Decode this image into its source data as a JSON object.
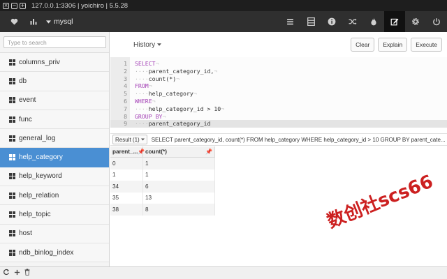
{
  "window": {
    "title": "127.0.0.1:3306 | yoichiro | 5.5.28",
    "controls": [
      "×",
      "−",
      "+"
    ]
  },
  "toolbar": {
    "database": "mysql",
    "left_icons": [
      "heart-icon",
      "bar-chart-icon"
    ],
    "right_icons": [
      "database-list-icon",
      "table-icon",
      "info-icon",
      "shuffle-icon",
      "fire-icon",
      "edit-icon",
      "gear-icon",
      "power-icon"
    ],
    "active_icon": "edit-icon"
  },
  "sidebar": {
    "search_placeholder": "Type to search",
    "selected": "help_category",
    "tables": [
      "columns_priv",
      "db",
      "event",
      "func",
      "general_log",
      "help_category",
      "help_keyword",
      "help_relation",
      "help_topic",
      "host",
      "ndb_binlog_index"
    ]
  },
  "query": {
    "history_label": "History",
    "buttons": {
      "clear": "Clear",
      "explain": "Explain",
      "execute": "Execute"
    },
    "line_numbers": [
      "1",
      "2",
      "3",
      "4",
      "5",
      "6",
      "7",
      "8",
      "9"
    ],
    "lines": [
      {
        "kw": "SELECT",
        "text": ""
      },
      {
        "kw": "",
        "text": "parent_category_id,"
      },
      {
        "kw": "",
        "text": "count(*)"
      },
      {
        "kw": "FROM",
        "text": ""
      },
      {
        "kw": "",
        "text": "help_category"
      },
      {
        "kw": "WHERE",
        "text": ""
      },
      {
        "kw": "",
        "text": "help_category_id > 10"
      },
      {
        "kw": "GROUP BY",
        "text": ""
      },
      {
        "kw": "",
        "text": "parent_category_id"
      }
    ]
  },
  "results": {
    "selector_label": "Result (1)",
    "sql": "SELECT parent_category_id, count(*) FROM help_category WHERE help_category_id > 10 GROUP BY parent_cate...",
    "columns": [
      "parent_...",
      "count(*)"
    ],
    "rows": [
      [
        "0",
        "1"
      ],
      [
        "1",
        "1"
      ],
      [
        "34",
        "6"
      ],
      [
        "35",
        "13"
      ],
      [
        "38",
        "8"
      ]
    ]
  },
  "bottombar": {
    "icons": [
      "refresh-icon",
      "add-icon",
      "trash-icon"
    ]
  },
  "watermark": "数创社scs66",
  "colors": {
    "selected": "#4a8fd3",
    "toolbar": "#2f2f2f",
    "keyword": "#a442b6",
    "watermark": "#cc2020"
  }
}
